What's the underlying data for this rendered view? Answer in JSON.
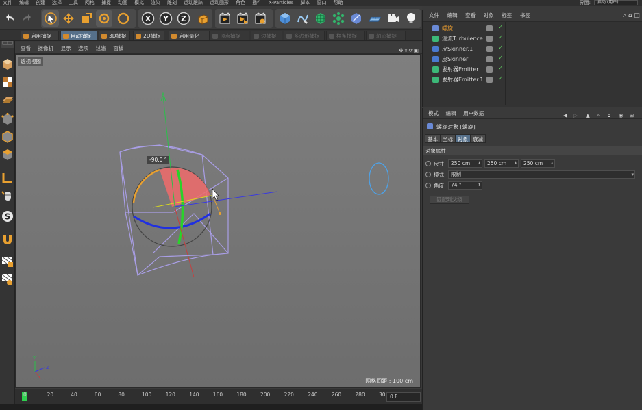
{
  "menubar": {
    "items": [
      "文件",
      "编辑",
      "创建",
      "选择",
      "工具",
      "网格",
      "捕捉",
      "动画",
      "模拟",
      "渲染",
      "雕刻",
      "运动跟踪",
      "运动图形",
      "角色",
      "插件",
      "X-Particles",
      "脚本",
      "窗口",
      "帮助"
    ],
    "layout_label": "界面:",
    "layout_value": "启动 (用户)"
  },
  "toolbar": {
    "icons": [
      "undo-icon",
      "redo-icon",
      "select-arrow-icon",
      "move-icon",
      "scale-icon",
      "rotate-icon",
      "rotate-recent-icon",
      "x-axis-lock-icon",
      "y-axis-lock-icon",
      "z-axis-lock-icon",
      "world-coordinates-icon",
      "render-view-icon",
      "render-picture-queue-icon",
      "render-settings-icon",
      "cube-icon",
      "pen-spline-icon",
      "subdivision-icon",
      "mograph-cloner-icon",
      "deformer-icon",
      "floor-plane-icon",
      "camera-icon",
      "light-icon"
    ],
    "axes": [
      "X",
      "Y",
      "Z"
    ]
  },
  "snapbar": {
    "buttons": [
      {
        "label": "启用捕捉",
        "state": "normal"
      },
      {
        "label": "自动捕捉",
        "state": "active"
      },
      {
        "label": "3D捕捉",
        "state": "normal"
      },
      {
        "label": "2D捕捉",
        "state": "normal"
      },
      {
        "label": "启用量化",
        "state": "normal"
      },
      {
        "label": "顶点捕捉",
        "state": "disabled"
      },
      {
        "label": "边捕捉",
        "state": "disabled"
      },
      {
        "label": "多边形捕捉",
        "state": "disabled"
      },
      {
        "label": "样条捕捉",
        "state": "disabled"
      },
      {
        "label": "轴心捕捉",
        "state": "disabled"
      }
    ]
  },
  "viewport": {
    "menu": [
      "查看",
      "摄像机",
      "显示",
      "选项",
      "过滤",
      "面板"
    ],
    "label": "透视视图",
    "angle_readout": "-90.0 °",
    "grid_distance": "网格间距 : 100 cm",
    "mini_axes": {
      "y": "Y",
      "z": "Z"
    }
  },
  "timeline": {
    "ticks": [
      "0",
      "20",
      "40",
      "60",
      "80",
      "100",
      "120",
      "140",
      "160",
      "180",
      "200",
      "220",
      "240",
      "260",
      "280",
      "300"
    ],
    "frame": "0 F",
    "current_frame": 0
  },
  "object_manager": {
    "menu": [
      "文件",
      "编辑",
      "查看",
      "对象",
      "标签",
      "书签"
    ],
    "objects": [
      {
        "name": "螺旋",
        "selected": true,
        "icon_color": "#6a8ad6"
      },
      {
        "name": "湍流Turbulence",
        "selected": false,
        "icon_color": "#3cb878"
      },
      {
        "name": "皮Skinner.1",
        "selected": false,
        "icon_color": "#4a7ad0"
      },
      {
        "name": "皮Skinner",
        "selected": false,
        "icon_color": "#4a7ad0"
      },
      {
        "name": "发射器Emitter",
        "selected": false,
        "icon_color": "#3cb878"
      },
      {
        "name": "发射器Emitter.1",
        "selected": false,
        "icon_color": "#3cb878"
      }
    ]
  },
  "attribute_manager": {
    "menu": [
      "模式",
      "编辑",
      "用户数据"
    ],
    "title": "螺旋对象 [螺旋]",
    "tabs": [
      {
        "label": "基本",
        "active": false
      },
      {
        "label": "坐标",
        "active": false
      },
      {
        "label": "对象",
        "active": true
      },
      {
        "label": "衰减",
        "active": false
      }
    ],
    "section": "对象属性",
    "size_label": "尺寸",
    "size_values": [
      "250 cm",
      "250 cm",
      "250 cm"
    ],
    "mode_label": "模式",
    "mode_value": "限制",
    "angle_label": "角度",
    "angle_value": "74 °",
    "fit_button": "匹配到父级"
  },
  "colors": {
    "selection_blue": "#56708a",
    "accent_orange": "#f0a030",
    "check_green": "#5ec45e"
  }
}
